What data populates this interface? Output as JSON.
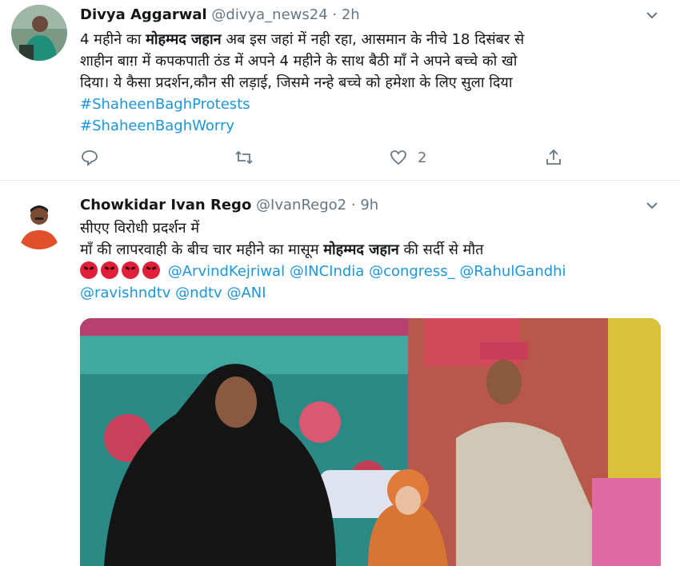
{
  "tweets": [
    {
      "name": "Divya Aggarwal",
      "handle": "@divya_news24",
      "separator": "·",
      "time": "2h",
      "text": {
        "l1_a": "4 महीने का ",
        "l1_b": "मोहम्मद जहान",
        "l1_c": " अब इस जहां में नही रहा, आसमान के नीचे 18 दिसंबर से",
        "l2": "शाहीन बाग़ में कपकपाती ठंड में अपने 4 महीने के साथ बैठी माँ ने अपने बच्चे को खो",
        "l3": "दिया। ये कैसा प्रदर्शन,कौन सी लड़ाई, जिसमे नन्हे बच्चे को हमेशा के लिए सुला दिया",
        "hashtag1": "#ShaheenBaghProtests",
        "hashtag2": "#ShaheenBaghWorry"
      },
      "actions": {
        "reply_icon": "reply-icon",
        "retweet_icon": "retweet-icon",
        "like_icon": "heart-icon",
        "like_count": "2",
        "share_icon": "share-icon"
      }
    },
    {
      "name": "Chowkidar Ivan Rego",
      "handle": "@IvanRego2",
      "separator": "·",
      "time": "9h",
      "text": {
        "l1": "सीएए विरोधी प्रदर्शन में",
        "l2_a": "माँ की लापरवाही के बीच  चार महीने का मासूम ",
        "l2_b": "मोहम्मद जहान",
        "l2_c": "  की सर्दी से  मौत",
        "mentions": [
          "@ArvindKejriwal",
          "@INCIndia",
          "@congress_",
          "@RahulGandhi",
          "@ravishndtv",
          "@ndtv",
          "@ANI"
        ]
      },
      "emoji_icon": "angry-face-icon",
      "emoji_count": 4
    }
  ],
  "colors": {
    "link": "#1b95e0",
    "secondary": "#657786",
    "text": "#14171a",
    "divider": "#e6ecf0"
  }
}
